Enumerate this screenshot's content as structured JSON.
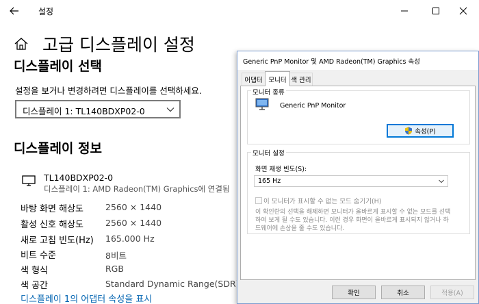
{
  "window": {
    "title": "설정"
  },
  "page": {
    "title": "고급 디스플레이 설정"
  },
  "select_section": {
    "heading": "디스플레이 선택",
    "description": "설정을 보거나 변경하려면 디스플레이를 선택하세요.",
    "selected_display": "디스플레이 1: TL140BDXP02-0"
  },
  "info_section": {
    "heading": "디스플레이 정보",
    "monitor_name": "TL140BDXP02-0",
    "monitor_connection": "디스플레이 1: AMD Radeon(TM) Graphics에 연결됨",
    "rows": [
      {
        "label": "바탕 화면 해상도",
        "value": "2560 × 1440"
      },
      {
        "label": "활성 신호 해상도",
        "value": "2560 × 1440"
      },
      {
        "label": "새로 고침 빈도(Hz)",
        "value": "165.000 Hz"
      },
      {
        "label": "비트 수준",
        "value": "8비트"
      },
      {
        "label": "색 형식",
        "value": "RGB"
      },
      {
        "label": "색 공간",
        "value": "Standard Dynamic Range(SDR)"
      }
    ],
    "adapter_link": "디스플레이 1의 어댑터 속성을 표시"
  },
  "dialog": {
    "title": "Generic PnP Monitor 및 AMD Radeon(TM) Graphics 속성",
    "tabs": [
      "어댑터",
      "모니터",
      "색 관리"
    ],
    "active_tab": "모니터",
    "monitor_type_label": "모니터 종류",
    "monitor_type_name": "Generic PnP Monitor",
    "properties_button": "속성(P)",
    "monitor_settings_label": "모니터 설정",
    "refresh_rate_label": "화면 재생 빈도(S):",
    "refresh_rate_value": "165 Hz",
    "hide_modes_checkbox": "이 모니터가 표시할 수 없는 모드 숨기기(H)",
    "hide_modes_checked": false,
    "help_lines": [
      "이 확인란의 선택을 해제하면 모니터가 올바르게 표시할 수 없는 모드를 선택",
      "하여 보게 될 수도 있습니다. 이런 경우 화면이 올바르게 표시되지 않거나 하",
      "드웨어에 손상을 줄 수도 있습니다."
    ],
    "buttons": {
      "ok": "확인",
      "cancel": "취소",
      "apply": "적용(A)"
    }
  },
  "colors": {
    "accent": "#0078d7",
    "link": "#0063b1"
  }
}
